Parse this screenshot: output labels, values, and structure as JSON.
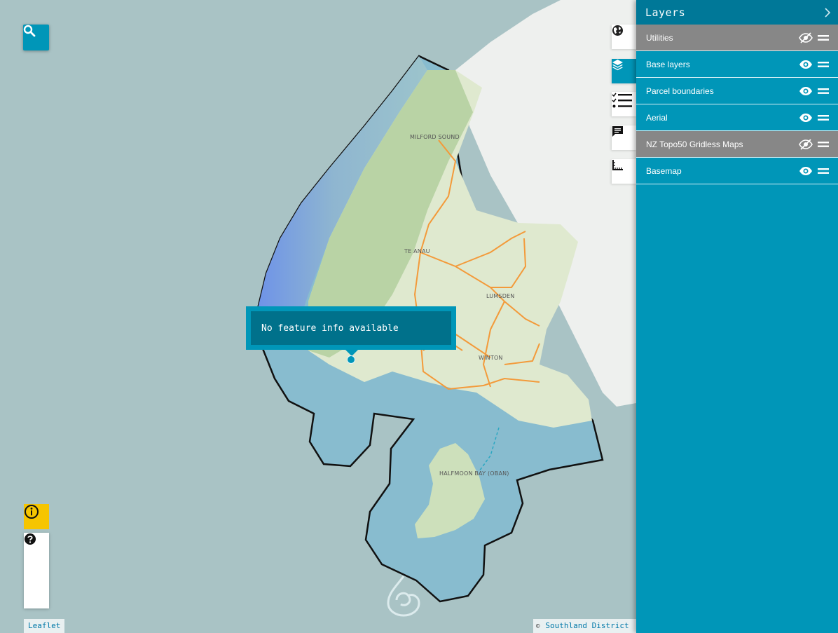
{
  "map": {
    "place_labels": [
      "MILFORD SOUND",
      "TE ANAU",
      "LUMSDEN",
      "WINTON",
      "HALFMOON BAY (OBAN)"
    ],
    "popup": {
      "text": "No feature info available"
    },
    "attribution_left": "Leaflet",
    "attribution_right": "Southland District"
  },
  "controls": {
    "search": "search-icon",
    "info": "info-icon",
    "zoom_in": "plus-icon",
    "zoom_out": "minus-icon",
    "help": "help-icon",
    "side_tools": [
      "globe-icon",
      "layers-icon",
      "legend-list-icon",
      "comment-icon",
      "measure-icon"
    ]
  },
  "layers_panel": {
    "title": "Layers",
    "items": [
      {
        "label": "Utilities",
        "visible": false
      },
      {
        "label": "Base layers",
        "visible": true
      },
      {
        "label": "Parcel boundaries",
        "visible": true
      },
      {
        "label": "Aerial",
        "visible": true
      },
      {
        "label": "NZ Topo50 Gridless Maps",
        "visible": false
      },
      {
        "label": "Basemap",
        "visible": true
      }
    ]
  },
  "colors": {
    "accent": "#0096b8",
    "header": "#007898",
    "hidden_row": "#878787",
    "info_button": "#f6c500",
    "roads": "#f39a3a"
  }
}
